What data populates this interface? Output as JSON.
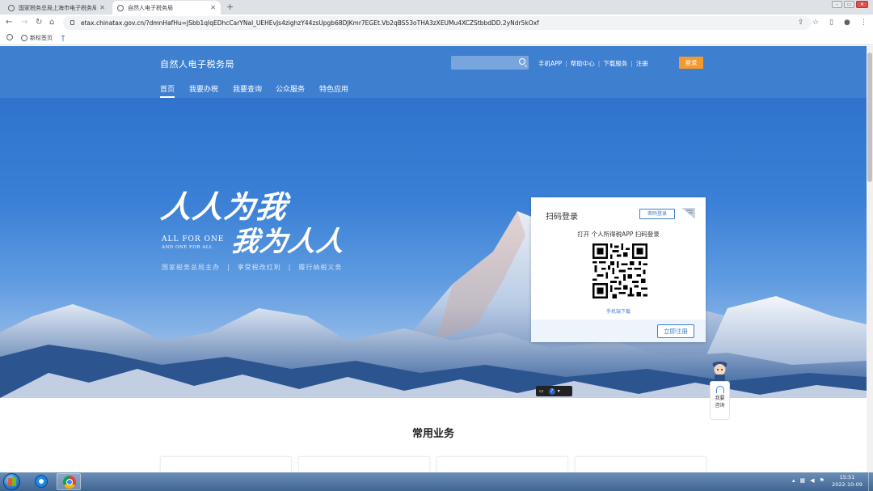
{
  "browser": {
    "tabs": [
      {
        "title": "国家税务总局上海市电子税务局",
        "active": false
      },
      {
        "title": "自然人电子税务局",
        "active": true
      }
    ],
    "new_tab": "+",
    "url": "etax.chinatax.gov.cn/?dmnHafHu=JSbb1qIqEDhcCarYNal_UEHEvJs4zighzY44zsUpgb68DJKmr7EGEt.Vb2qBS53oTHA3zXEUMu4XCZStbbdDD.2yNdr5kOxf",
    "bookmarks": [
      {
        "label": ""
      },
      {
        "label": "新标签页"
      },
      {
        "label": ""
      }
    ]
  },
  "header": {
    "logo": "自然人电子税务局",
    "search_placeholder": "",
    "links": [
      "手机APP",
      "帮助中心",
      "下载服务",
      "注册"
    ],
    "login_label": "登录",
    "nav": [
      "首页",
      "我要办税",
      "我要查询",
      "公众服务",
      "特色应用"
    ],
    "active_nav": "首页"
  },
  "hero": {
    "slogan_line1": "人人为我",
    "slogan_line2": "我为人人",
    "english_line1": "ALL FOR ONE",
    "english_line2": "AND ONE FOR ALL",
    "tagline": [
      "国家税务总局主办",
      "享受税改红利",
      "履行纳税义务"
    ]
  },
  "login_panel": {
    "title": "扫码登录",
    "mode_tag": "密码登录",
    "hint": "打开 个人所得税APP 扫码登录",
    "download_link": "手机端下载",
    "register_button": "立即注册"
  },
  "assistant": {
    "label_line1": "我要",
    "label_line2": "咨询"
  },
  "section": {
    "title": "常用业务"
  },
  "taskbar": {
    "time": "15:51",
    "date": "2022-10-09"
  },
  "colors": {
    "header_blue": "#3e7fd0",
    "login_orange": "#f39a2b"
  }
}
